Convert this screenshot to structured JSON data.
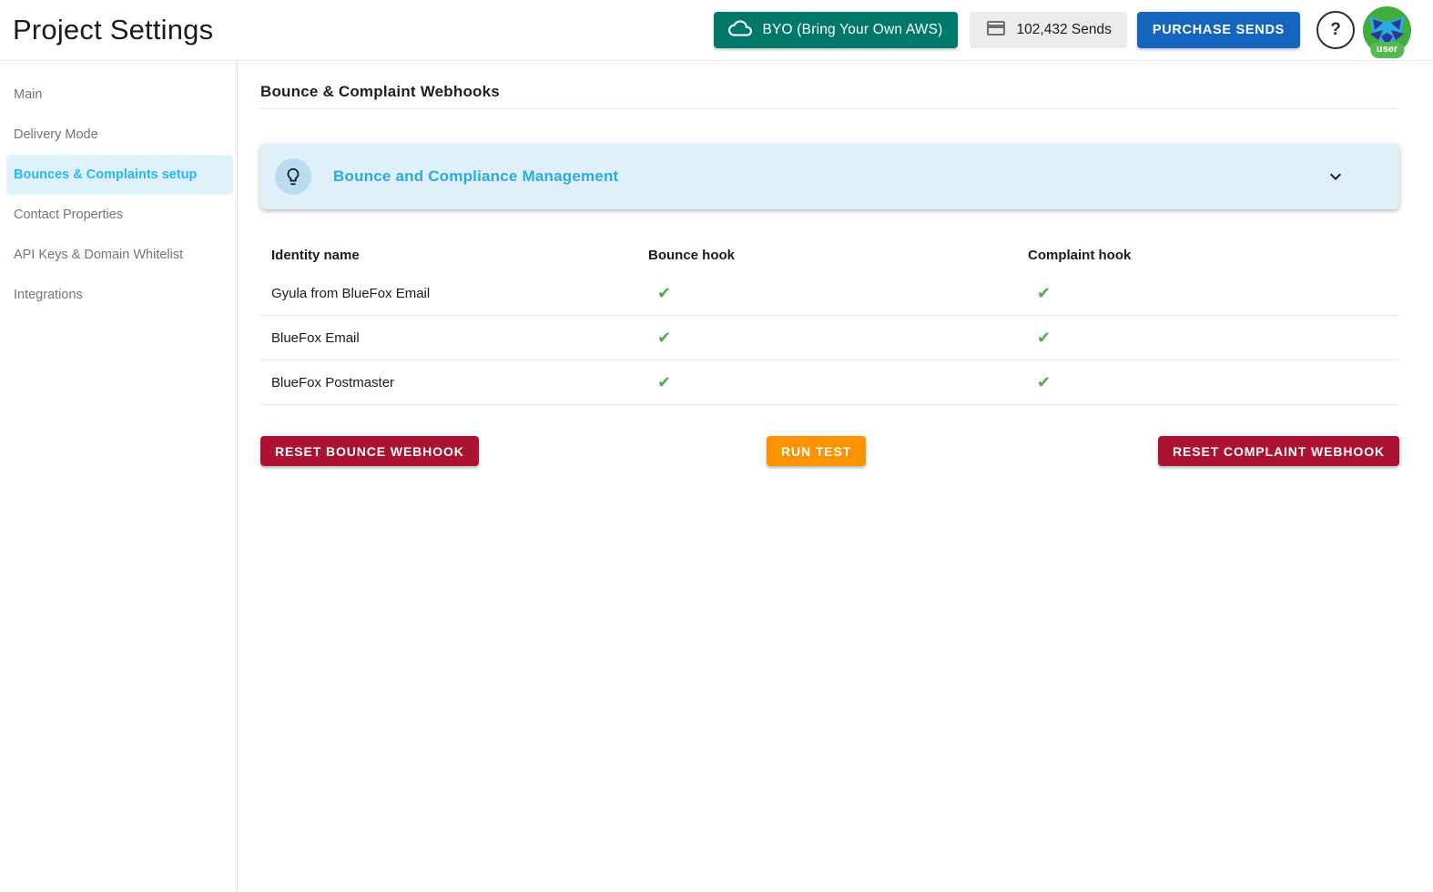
{
  "header": {
    "title": "Project Settings",
    "byo_button_label": "BYO (Bring Your Own AWS)",
    "sends_badge_label": "102,432 Sends",
    "purchase_button_label": "PURCHASE SENDS",
    "help_label": "?",
    "avatar_badge_label": "user"
  },
  "sidebar": {
    "items": [
      {
        "label": "Main"
      },
      {
        "label": "Delivery Mode"
      },
      {
        "label": "Bounces & Complaints setup"
      },
      {
        "label": "Contact Properties"
      },
      {
        "label": "API Keys & Domain Whitelist"
      },
      {
        "label": "Integrations"
      }
    ],
    "active_index": 2
  },
  "main": {
    "heading": "Bounce & Complaint Webhooks",
    "banner": {
      "title": "Bounce and Compliance Management",
      "icon": "lightbulb-icon",
      "expand_icon": "chevron-down-icon",
      "collapsed": true
    },
    "table": {
      "columns": [
        "Identity name",
        "Bounce hook",
        "Complaint hook"
      ],
      "rows": [
        {
          "identity": "Gyula from BlueFox Email",
          "bounce_hook": "✔",
          "complaint_hook": "✔"
        },
        {
          "identity": "BlueFox Email",
          "bounce_hook": "✔",
          "complaint_hook": "✔"
        },
        {
          "identity": "BlueFox Postmaster",
          "bounce_hook": "✔",
          "complaint_hook": "✔"
        }
      ]
    },
    "actions": {
      "reset_bounce_label": "RESET BOUNCE WEBHOOK",
      "run_test_label": "RUN TEST",
      "reset_complaint_label": "RESET COMPLAINT WEBHOOK"
    }
  },
  "colors": {
    "nav_active_text": "#29B6F6",
    "nav_active_bg": "#DFF2FC",
    "banner_bg": "#E0F0FB",
    "banner_title": "#29ABE2",
    "check_green": "#4CAF50",
    "byo_teal": "#00796B",
    "purchase_blue": "#1565C0",
    "reset_red": "#AC1232",
    "run_test_orange": "#FB9300",
    "avatar_green": "#3FAE3F"
  }
}
